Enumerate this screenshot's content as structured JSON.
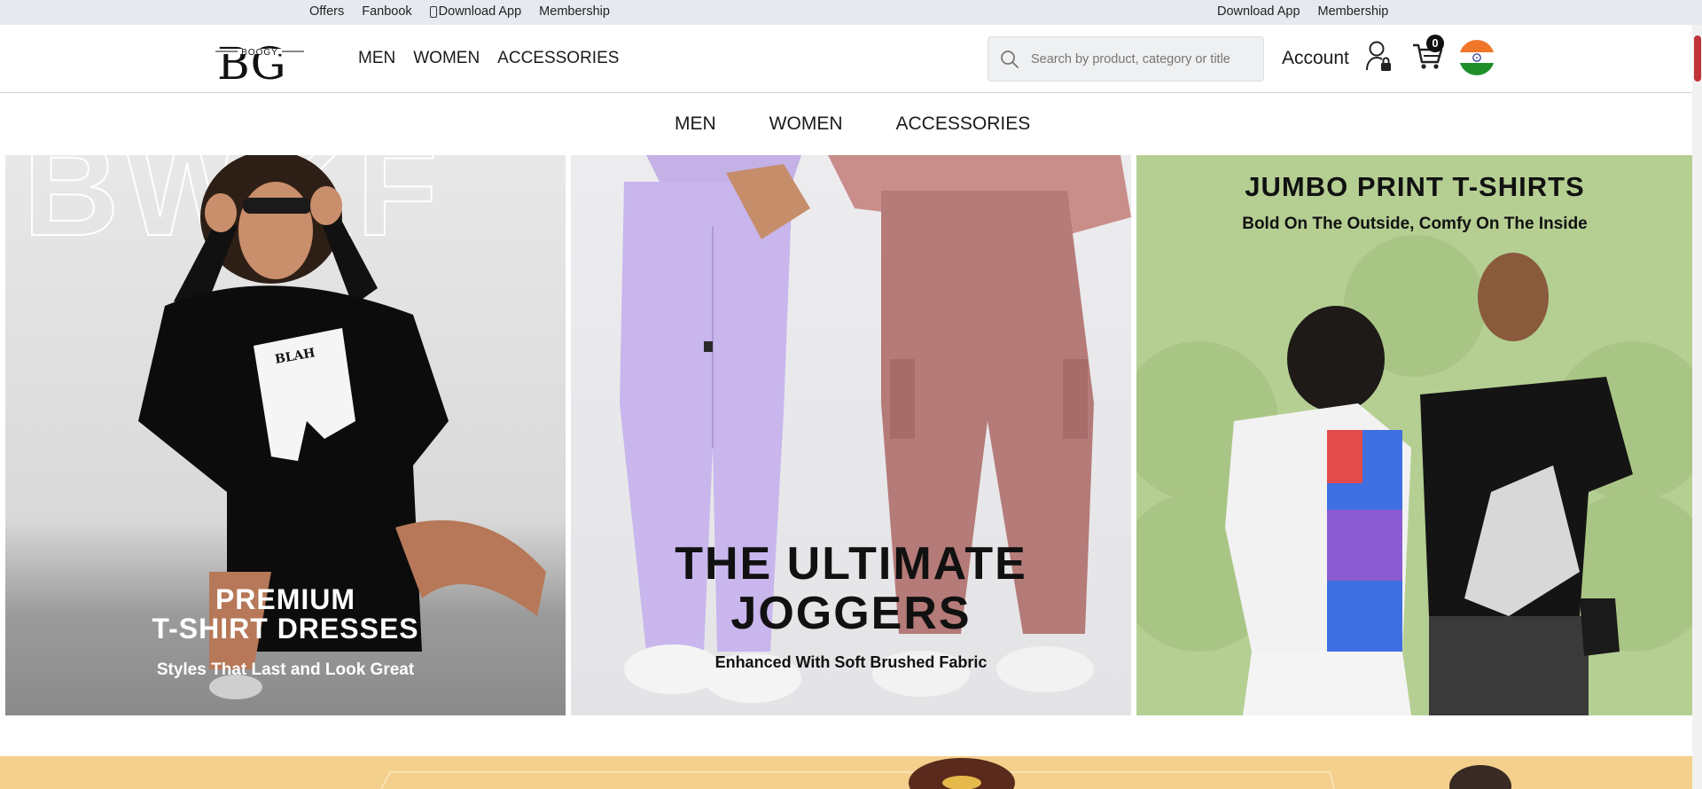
{
  "topbar": {
    "left_links": [
      "Offers",
      "Fanbook",
      "Download App",
      "Membership"
    ],
    "right_links": [
      "Download App",
      "Membership"
    ]
  },
  "header": {
    "logo_text": "BOOGY",
    "logo_letters": "BG",
    "nav": [
      "MEN",
      "WOMEN",
      "ACCESSORIES"
    ],
    "search_placeholder": "Search by product, category or title",
    "account_label": "Account",
    "cart_count": "0",
    "icons": [
      "search-icon",
      "user-lock-icon",
      "cart-icon",
      "india-flag-icon"
    ]
  },
  "subnav": {
    "items": [
      "MEN",
      "WOMEN",
      "ACCESSORIES"
    ]
  },
  "banners": [
    {
      "title_line1": "PREMIUM",
      "title_line2": "T-SHIRT DRESSES",
      "subtitle": "Styles That Last and Look Great",
      "watermark": "BWKF"
    },
    {
      "title_line1": "THE ULTIMATE",
      "title_line2": "JOGGERS",
      "subtitle": "Enhanced With Soft Brushed Fabric"
    },
    {
      "title": "JUMBO PRINT T-SHIRTS",
      "subtitle": "Bold On The Outside, Comfy On The Inside"
    }
  ],
  "colors": {
    "topbar_bg": "#e6eaf0",
    "banner3_bg": "#b5cf93",
    "promo_bg": "#f3d08c",
    "scroll_thumb": "#c0333a"
  }
}
